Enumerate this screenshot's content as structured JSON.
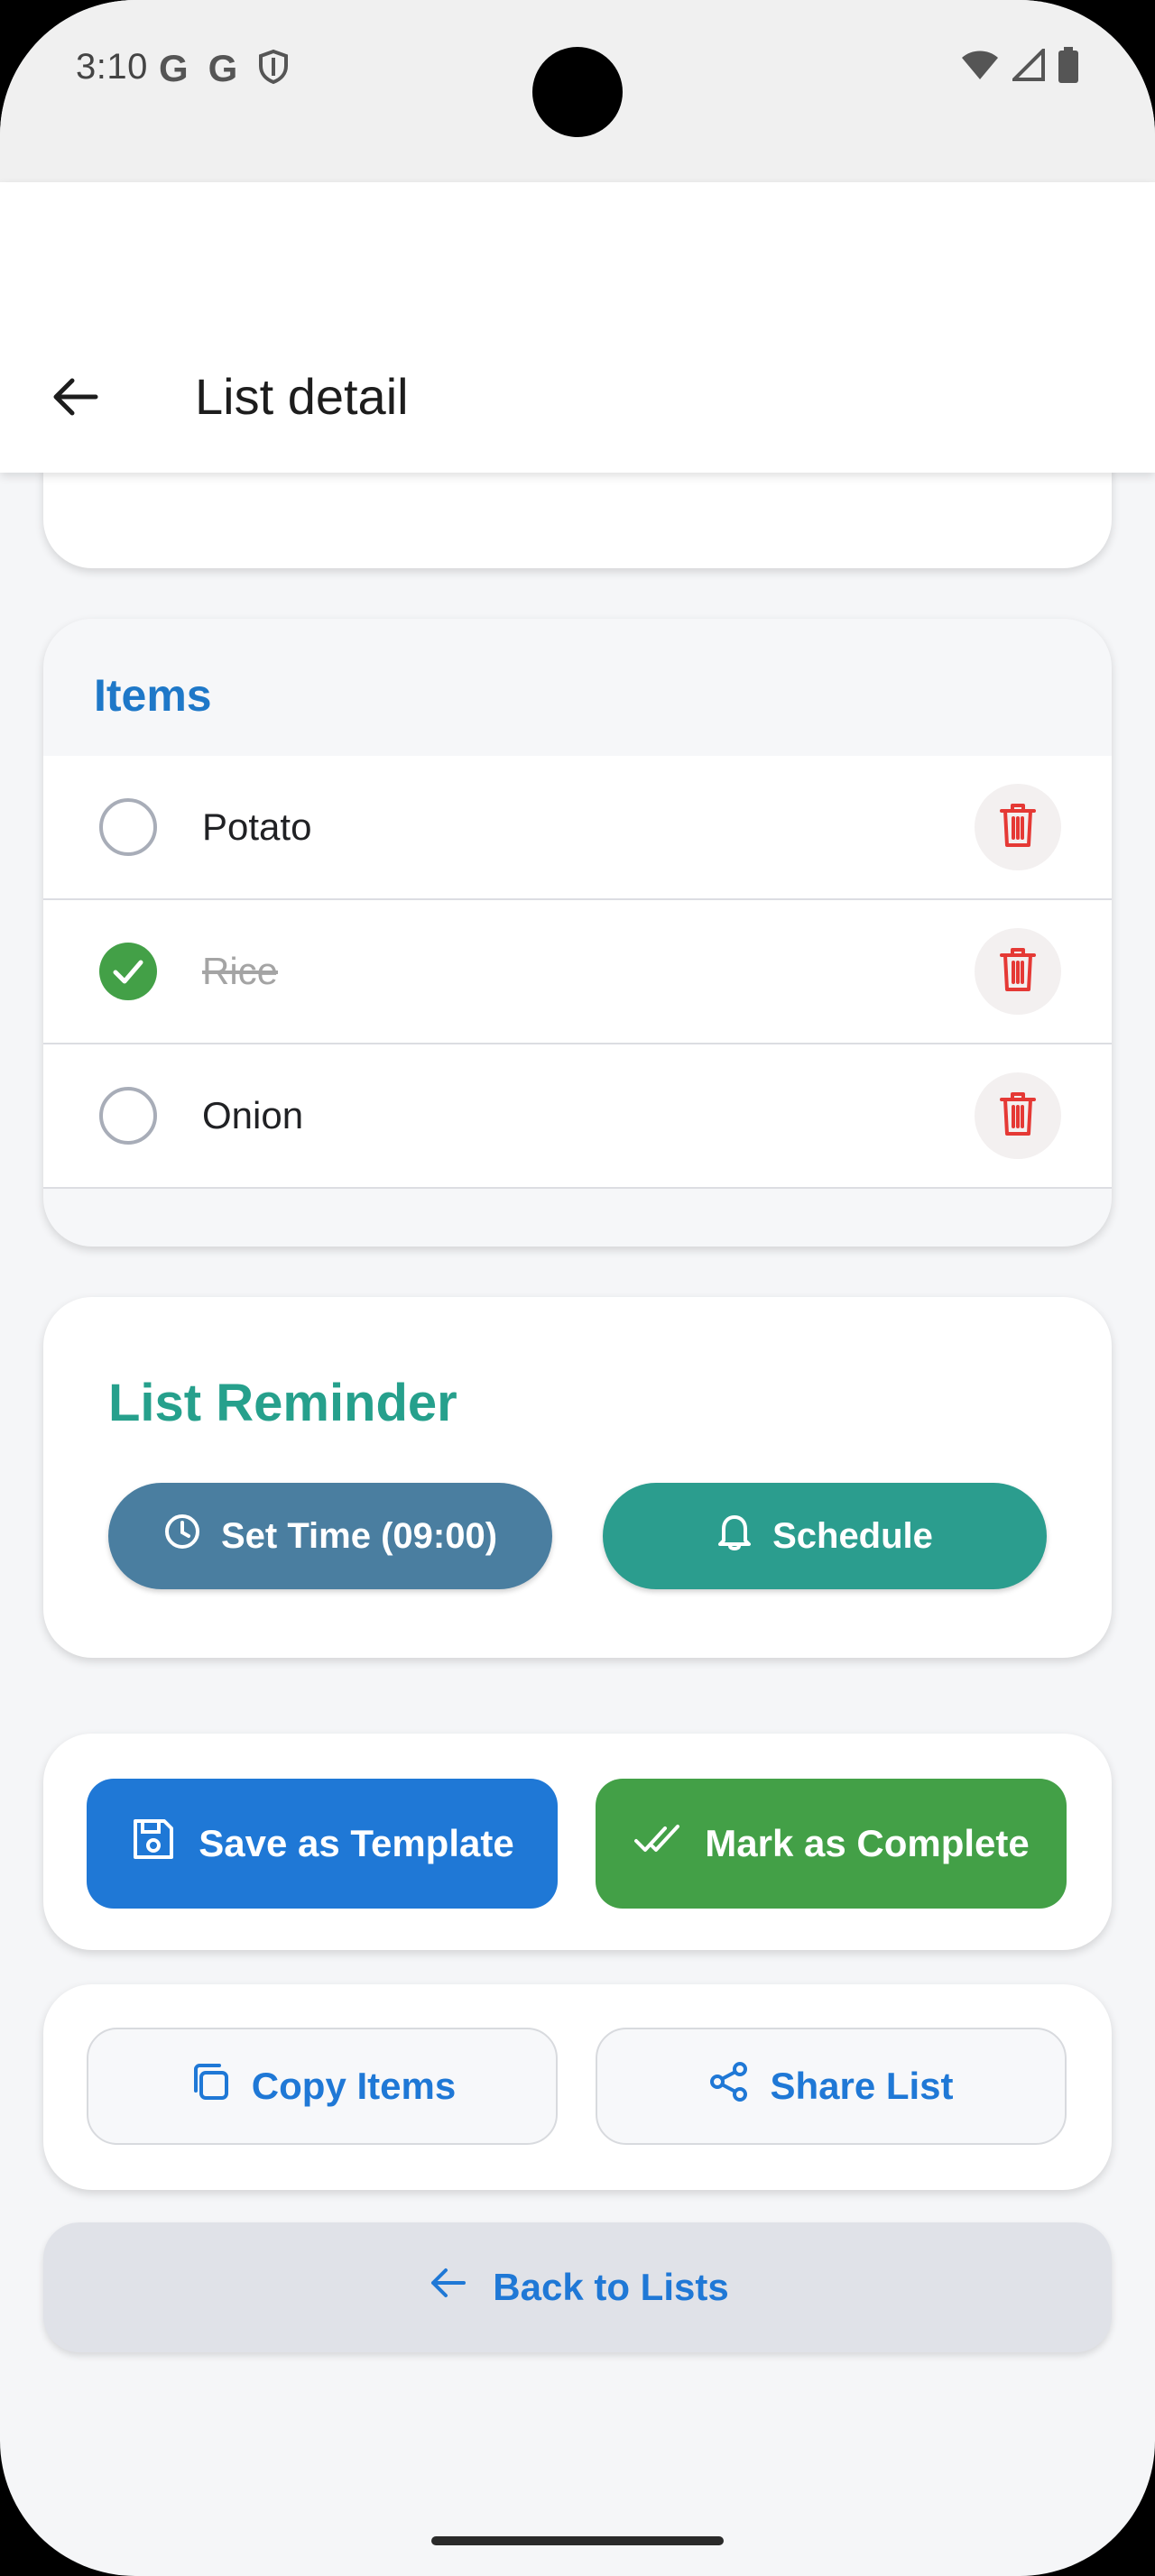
{
  "status_bar": {
    "time": "3:10",
    "left_icons": [
      "G",
      "G"
    ],
    "right_icons": [
      "wifi-icon",
      "signal-icon",
      "battery-icon"
    ]
  },
  "app_bar": {
    "title": "List detail",
    "back_icon": "arrow-left-icon"
  },
  "items_card": {
    "title": "Items",
    "items": [
      {
        "label": "Potato",
        "checked": false
      },
      {
        "label": "Rice",
        "checked": true
      },
      {
        "label": "Onion",
        "checked": false
      }
    ]
  },
  "reminder": {
    "title": "List Reminder",
    "set_time_label": "Set Time (09:00)",
    "schedule_label": "Schedule"
  },
  "actions": {
    "save_template_label": "Save as Template",
    "mark_complete_label": "Mark as Complete",
    "copy_items_label": "Copy Items",
    "share_list_label": "Share List",
    "back_to_lists_label": "Back to Lists"
  },
  "colors": {
    "primary_blue": "#1f78d6",
    "success_green": "#43a047",
    "teal": "#2b9d8e",
    "slate_blue": "#4a7ea0",
    "delete_red": "#e53935"
  }
}
